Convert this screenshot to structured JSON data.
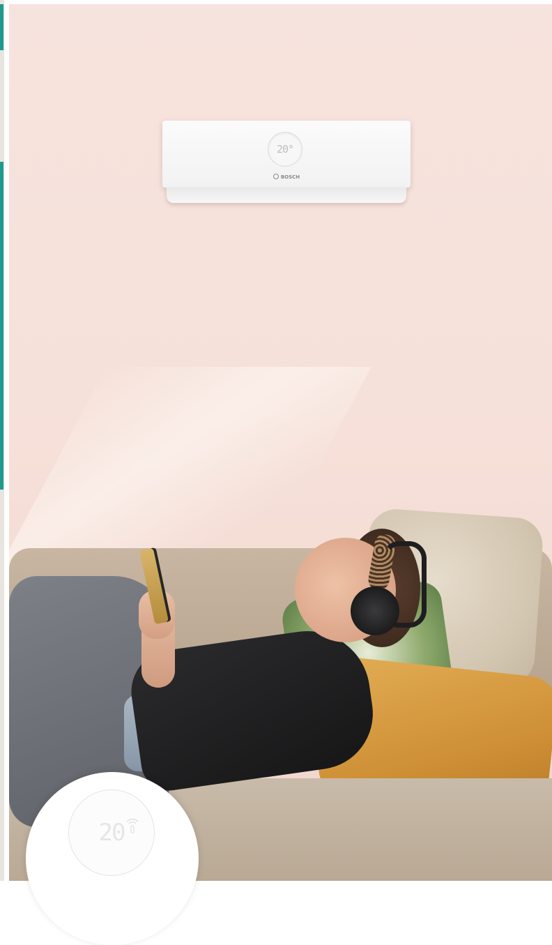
{
  "ac_unit": {
    "display_temp": "20°",
    "brand": "BOSCH"
  },
  "thermostat": {
    "display_temp": "20"
  },
  "colors": {
    "accent_teal": "#1f9a8f",
    "wall": "#f6e1da",
    "pillow_orange": "#cf9036"
  },
  "icons": [
    "bosch-logo-icon",
    "wifi-icon"
  ]
}
